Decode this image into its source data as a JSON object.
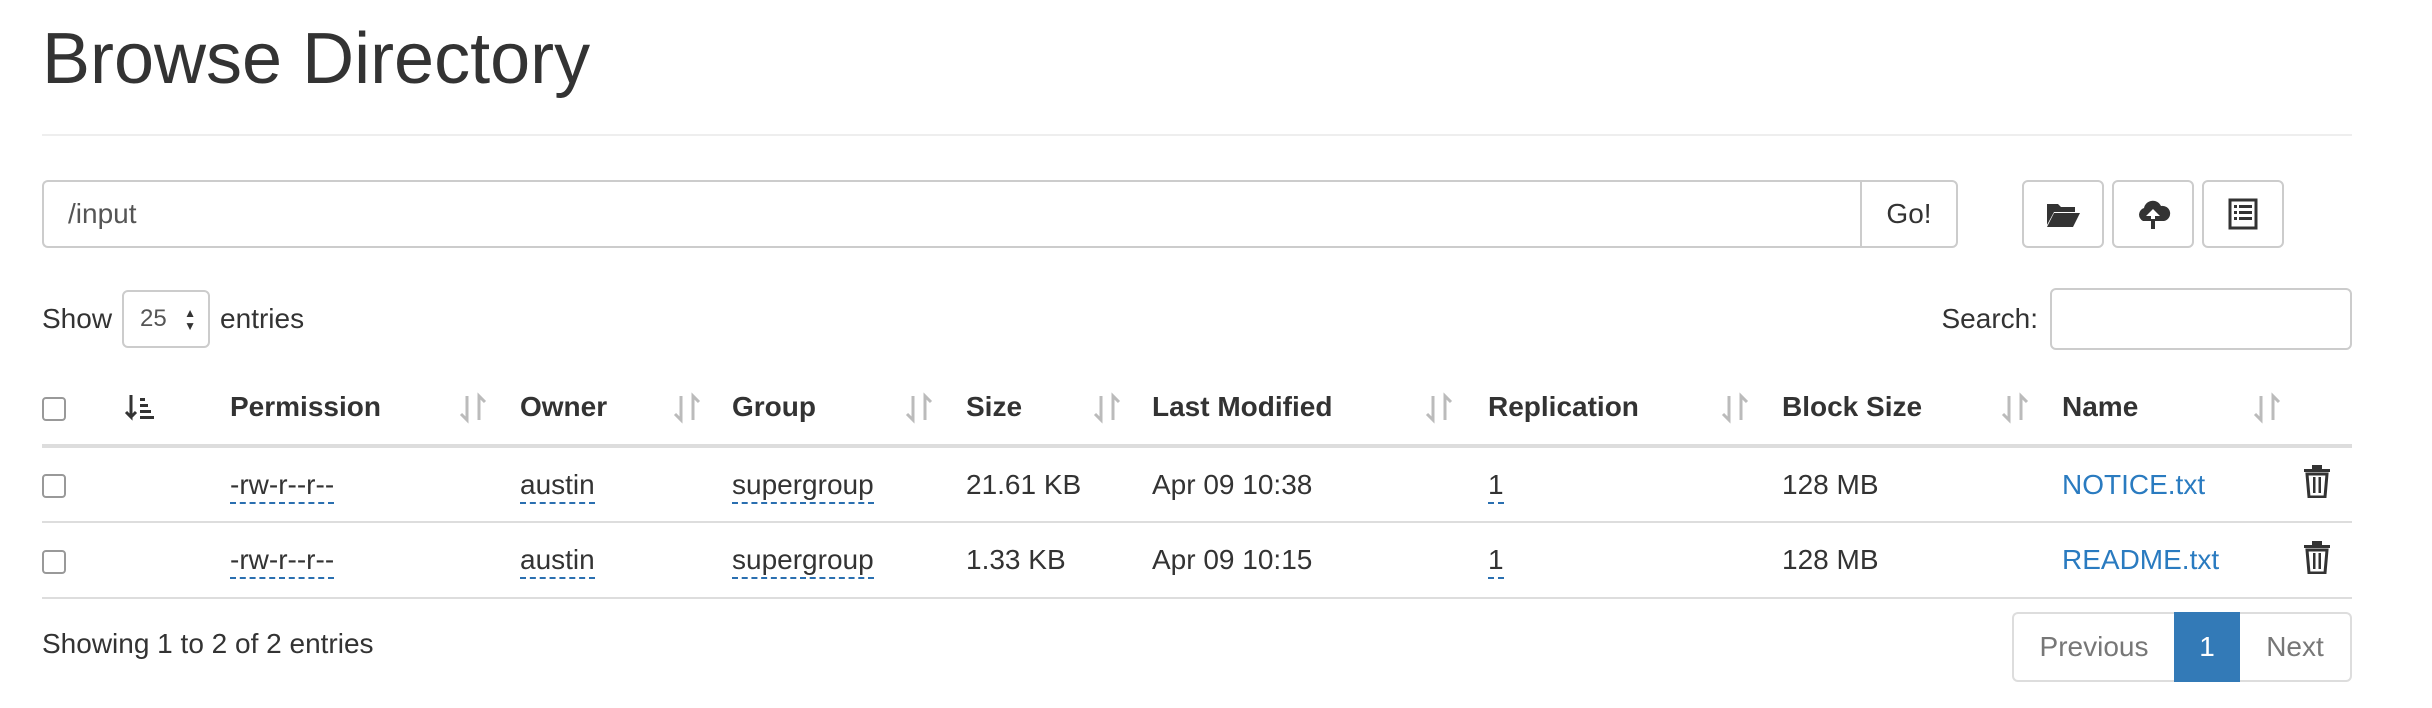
{
  "page": {
    "title": "Browse Directory"
  },
  "path_bar": {
    "value": "/input",
    "go_label": "Go!"
  },
  "toolbar": {
    "create_directory_icon": "folder-open-icon",
    "upload_icon": "cloud-upload-icon",
    "cut_paste_icon": "list-alt-icon"
  },
  "length": {
    "show_label": "Show",
    "selected": "25",
    "entries_label": "entries"
  },
  "search": {
    "label": "Search:",
    "value": ""
  },
  "table": {
    "headers": {
      "permission": "Permission",
      "owner": "Owner",
      "group": "Group",
      "size": "Size",
      "last_modified": "Last Modified",
      "replication": "Replication",
      "block_size": "Block Size",
      "name": "Name"
    },
    "rows": [
      {
        "permission": "-rw-r--r--",
        "owner": "austin",
        "group": "supergroup",
        "size": "21.61 KB",
        "last_modified": "Apr 09 10:38",
        "replication": "1",
        "block_size": "128 MB",
        "name": "NOTICE.txt"
      },
      {
        "permission": "-rw-r--r--",
        "owner": "austin",
        "group": "supergroup",
        "size": "1.33 KB",
        "last_modified": "Apr 09 10:15",
        "replication": "1",
        "block_size": "128 MB",
        "name": "README.txt"
      }
    ]
  },
  "footer": {
    "info": "Showing 1 to 2 of 2 entries",
    "previous": "Previous",
    "current_page": "1",
    "next": "Next"
  },
  "colors": {
    "link": "#2a7bc0",
    "active_page": "#337ab7"
  }
}
